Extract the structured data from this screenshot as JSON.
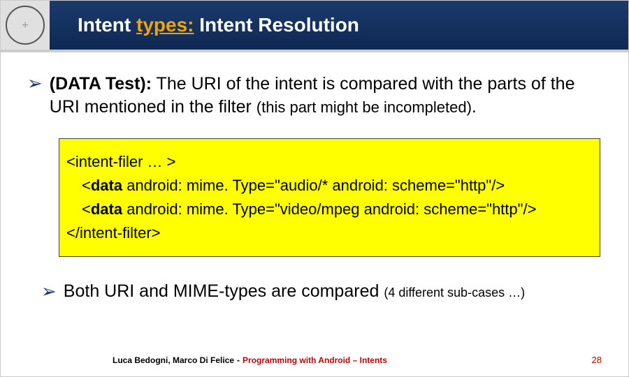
{
  "header": {
    "title_prefix": "Intent ",
    "title_accent": "types:",
    "title_suffix": " Intent Resolution",
    "logo_alt": "University seal"
  },
  "bullet": {
    "marker": "➢",
    "bold_lead": "(DATA Test):",
    "rest": " The URI of the intent is compared with the parts of the URI mentioned in the filter ",
    "paren": "(this part might be incompleted)",
    "dot": "."
  },
  "code": {
    "line1_open": "<intent-filer … >",
    "line2_pre": "<",
    "line2_bold": "data",
    "line2_rest": " android: mime. Type=\"audio/*  android: scheme=\"http\"/>",
    "line3_pre": "<",
    "line3_bold": "data",
    "line3_rest": " android: mime. Type=\"video/mpeg  android: scheme=\"http\"/>",
    "line4_close": "</intent-filter>"
  },
  "note": {
    "marker": "➢",
    "main": "Both URI and MIME-types are compared ",
    "paren": "(4 different sub-cases …)"
  },
  "footer": {
    "authors": "Luca Bedogni, Marco Di Felice",
    "dash": " - ",
    "topic": "Programming with Android – Intents",
    "page": "28"
  }
}
